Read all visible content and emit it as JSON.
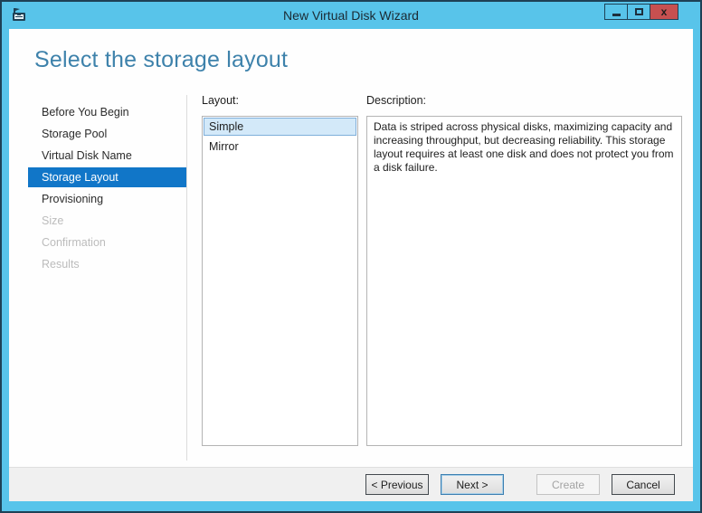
{
  "window": {
    "title": "New Virtual Disk Wizard",
    "controls": {
      "close_glyph": "x"
    }
  },
  "page": {
    "heading": "Select the storage layout"
  },
  "sidebar": {
    "items": [
      {
        "label": "Before You Begin",
        "state": "enabled"
      },
      {
        "label": "Storage Pool",
        "state": "enabled"
      },
      {
        "label": "Virtual Disk Name",
        "state": "enabled"
      },
      {
        "label": "Storage Layout",
        "state": "selected"
      },
      {
        "label": "Provisioning",
        "state": "enabled"
      },
      {
        "label": "Size",
        "state": "disabled"
      },
      {
        "label": "Confirmation",
        "state": "disabled"
      },
      {
        "label": "Results",
        "state": "disabled"
      }
    ]
  },
  "layout_panel": {
    "label": "Layout:",
    "options": [
      {
        "label": "Simple",
        "selected": true
      },
      {
        "label": "Mirror",
        "selected": false
      }
    ]
  },
  "description_panel": {
    "label": "Description:",
    "text": "Data is striped across physical disks, maximizing capacity and increasing throughput, but decreasing reliability. This storage layout requires at least one disk and does not protect you from a disk failure."
  },
  "footer": {
    "buttons": [
      {
        "label": "< Previous",
        "state": "enabled"
      },
      {
        "label": "Next >",
        "state": "default"
      },
      {
        "label": "Create",
        "state": "disabled"
      },
      {
        "label": "Cancel",
        "state": "enabled"
      }
    ]
  },
  "colors": {
    "titlebar": "#58c4ea",
    "frame_border": "#1e4156",
    "step_selected": "#1176c8",
    "close_button": "#c75050",
    "heading": "#3e82ab",
    "list_selection_bg": "#d3e9f9",
    "footer_bg": "#f0f0f0"
  }
}
